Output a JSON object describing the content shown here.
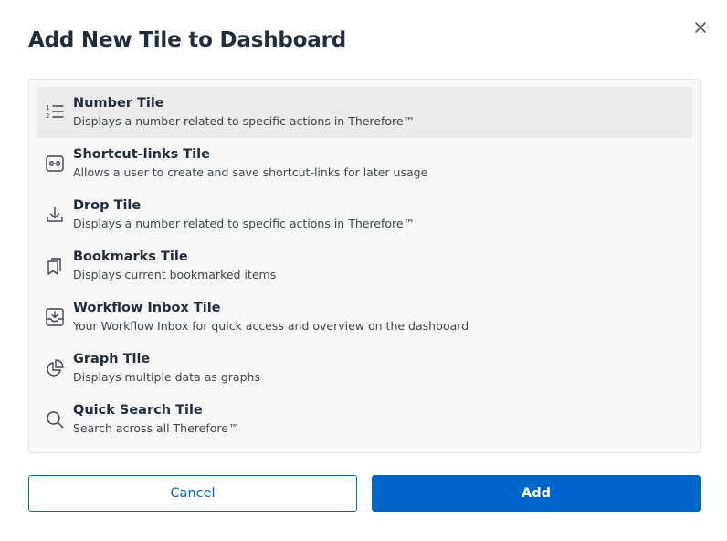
{
  "dialog": {
    "title": "Add New Tile to Dashboard",
    "close_icon": "close-icon"
  },
  "tiles": [
    {
      "name": "Number Tile",
      "description": "Displays a number related to specific actions in Therefore™",
      "icon": "numbered-list-icon",
      "selected": true
    },
    {
      "name": "Shortcut-links Tile",
      "description": "Allows a user to create and save shortcut-links for later usage",
      "icon": "link-icon",
      "selected": false
    },
    {
      "name": "Drop Tile",
      "description": "Displays a number related to specific actions in Therefore™",
      "icon": "download-icon",
      "selected": false
    },
    {
      "name": "Bookmarks Tile",
      "description": "Displays current bookmarked items",
      "icon": "bookmarks-icon",
      "selected": false
    },
    {
      "name": "Workflow Inbox Tile",
      "description": "Your Workflow Inbox for quick access and overview on the dashboard",
      "icon": "inbox-icon",
      "selected": false
    },
    {
      "name": "Graph Tile",
      "description": "Displays multiple data as graphs",
      "icon": "pie-chart-icon",
      "selected": false
    },
    {
      "name": "Quick Search Tile",
      "description": "Search across all Therefore™",
      "icon": "search-icon",
      "selected": false
    }
  ],
  "buttons": {
    "cancel_label": "Cancel",
    "add_label": "Add"
  },
  "colors": {
    "primary": "#0066cc",
    "text": "#1f2d3d",
    "selected_row": "#ebebeb",
    "list_background": "#f8f8f8"
  }
}
